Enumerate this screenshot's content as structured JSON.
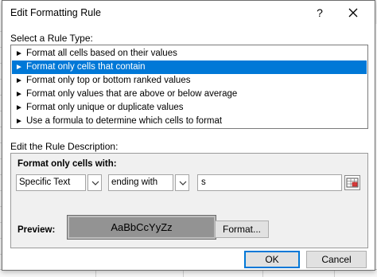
{
  "dialog": {
    "title": "Edit Formatting Rule",
    "help_label": "?",
    "close_label": "✕"
  },
  "rule_type": {
    "label": "Select a Rule Type:",
    "items": [
      {
        "label": "Format all cells based on their values",
        "selected": false
      },
      {
        "label": "Format only cells that contain",
        "selected": true
      },
      {
        "label": "Format only top or bottom ranked values",
        "selected": false
      },
      {
        "label": "Format only values that are above or below average",
        "selected": false
      },
      {
        "label": "Format only unique or duplicate values",
        "selected": false
      },
      {
        "label": "Use a formula to determine which cells to format",
        "selected": false
      }
    ]
  },
  "description": {
    "label": "Edit the Rule Description:",
    "subheading": "Format only cells with:",
    "condition_type": "Specific Text",
    "operator": "ending with",
    "value": "s",
    "preview_label": "Preview:",
    "preview_sample": "AaBbCcYyZz",
    "format_button": "Format..."
  },
  "buttons": {
    "ok": "OK",
    "cancel": "Cancel"
  },
  "colors": {
    "selection": "#0078d7",
    "preview_fill": "#939393",
    "panel": "#f0f0f0"
  }
}
